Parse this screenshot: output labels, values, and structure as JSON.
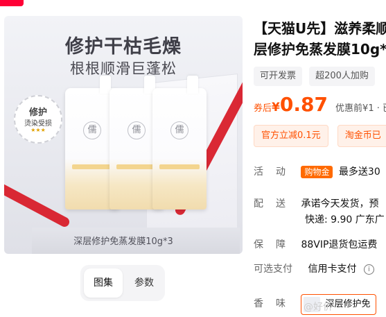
{
  "image": {
    "headline": "修护干枯毛燥",
    "subheadline": "根根顺滑巨蓬松",
    "badge_title": "修护",
    "badge_sub": "烫染受损",
    "badge_stars": "★★★",
    "sachet_emblem": "儒",
    "caption": "深层修护免蒸发膜10g*3"
  },
  "thumb_tabs": [
    {
      "label": "图集"
    },
    {
      "label": "参数"
    }
  ],
  "product": {
    "title_line1": "【天猫U先】滋养柔顺",
    "title_line2": "层修护免蒸发膜10g*"
  },
  "tags": [
    "可开发票",
    "超200人加购"
  ],
  "price": {
    "label": "券后",
    "currency": "¥",
    "amount": "0.87",
    "before": "优惠前¥1 · 已"
  },
  "coupons": [
    "官方立减0.1元",
    "淘金币已"
  ],
  "attrs": {
    "activity": {
      "key": "活动",
      "badge": "购物金",
      "value": "最多送30"
    },
    "delivery": {
      "key": "配送",
      "green": "承诺今天发货，预",
      "line2": "快递: 9.90  广东广"
    },
    "guarantee": {
      "key": "保障",
      "value": "88VIP退货包运费"
    },
    "payment": {
      "key": "可选支付",
      "value": "信用卡支付"
    },
    "flavor": {
      "key": "香味",
      "chip": "深层修护免"
    }
  },
  "watermark": "@好价"
}
